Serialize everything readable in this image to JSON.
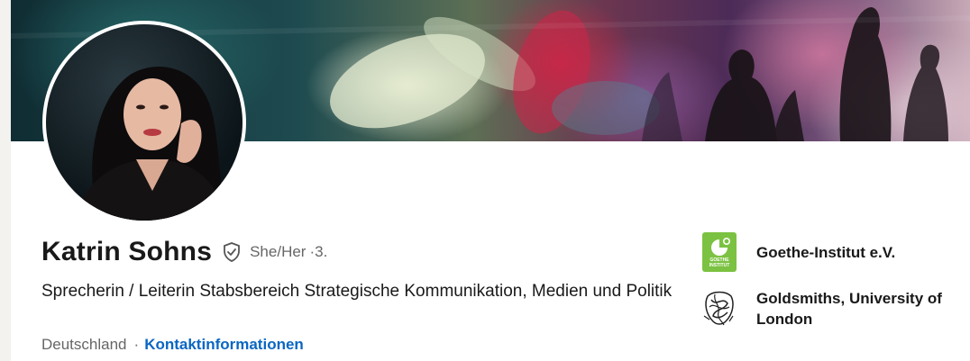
{
  "profile": {
    "name": "Katrin Sohns",
    "pronouns": "She/Her",
    "degree": "·3.",
    "headline": "Sprecherin / Leiterin Stabsbereich Strategische Kommunikation, Medien und Politik",
    "location": "Deutschland",
    "separator": "·",
    "contact_link": "Kontaktinformationen"
  },
  "organizations": [
    {
      "name": "Goethe-Institut e.V.",
      "logo_icon": "goethe-institut-logo"
    },
    {
      "name": "Goldsmiths, University of London",
      "logo_icon": "goldsmiths-crest"
    }
  ],
  "goethe_logo_text": "GOETHE INSTITUT",
  "colors": {
    "link": "#0a66c2",
    "goethe_green": "#7cc242",
    "text_primary": "#191919",
    "text_secondary": "#666666"
  }
}
